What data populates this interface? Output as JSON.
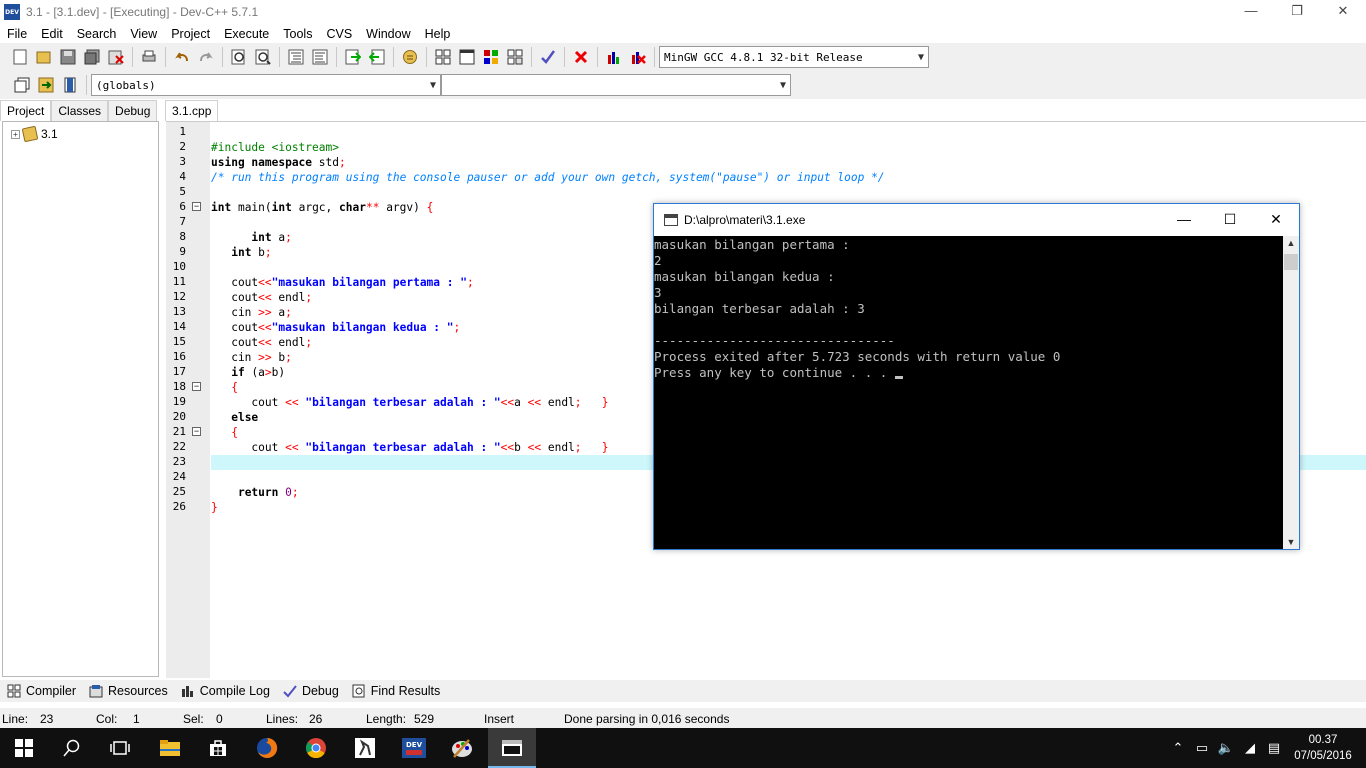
{
  "window": {
    "title": "3.1 - [3.1.dev] - [Executing] - Dev-C++ 5.7.1",
    "app_icon_text": "DEV",
    "controls": [
      "—",
      "❐",
      "✕"
    ]
  },
  "menu": [
    "File",
    "Edit",
    "Search",
    "View",
    "Project",
    "Execute",
    "Tools",
    "CVS",
    "Window",
    "Help"
  ],
  "toolbar": {
    "compiler_select": "MinGW GCC 4.8.1 32-bit Release",
    "scope_select": "(globals)",
    "member_select": ""
  },
  "left_panel": {
    "tabs": [
      "Project",
      "Classes",
      "Debug"
    ],
    "active_tab": "Project",
    "tree": [
      {
        "label": "3.1",
        "expander": "+"
      }
    ]
  },
  "editor": {
    "file_tab": "3.1.cpp",
    "current_line": 23
  },
  "console": {
    "title": "D:\\alpro\\materi\\3.1.exe",
    "controls": [
      "—",
      "☐",
      "✕"
    ],
    "lines": [
      "masukan bilangan pertama :",
      "2",
      "masukan bilangan kedua :",
      "3",
      "bilangan terbesar adalah : 3",
      "",
      "--------------------------------",
      "Process exited after 5.723 seconds with return value 0",
      "Press any key to continue . . . "
    ]
  },
  "bottom_tabs": [
    "Compiler",
    "Resources",
    "Compile Log",
    "Debug",
    "Find Results"
  ],
  "status": {
    "line_label": "Line:",
    "line_value": "23",
    "col_label": "Col:",
    "col_value": "1",
    "sel_label": "Sel:",
    "sel_value": "0",
    "lines_label": "Lines:",
    "lines_value": "26",
    "length_label": "Length:",
    "length_value": "529",
    "mode": "Insert",
    "message": "Done parsing in 0,016 seconds"
  },
  "taskbar": {
    "clock_time": "00.37",
    "clock_date": "07/05/2016"
  },
  "colors": {
    "keyword": "#000000",
    "string": "#0000ff",
    "symbol": "#ff0000",
    "preprocessor": "#008000",
    "comment": "#0080ff",
    "number": "#800080",
    "current_line": "#cdf7fb",
    "console_bg": "#000000",
    "console_fg": "#c0c0c0"
  }
}
